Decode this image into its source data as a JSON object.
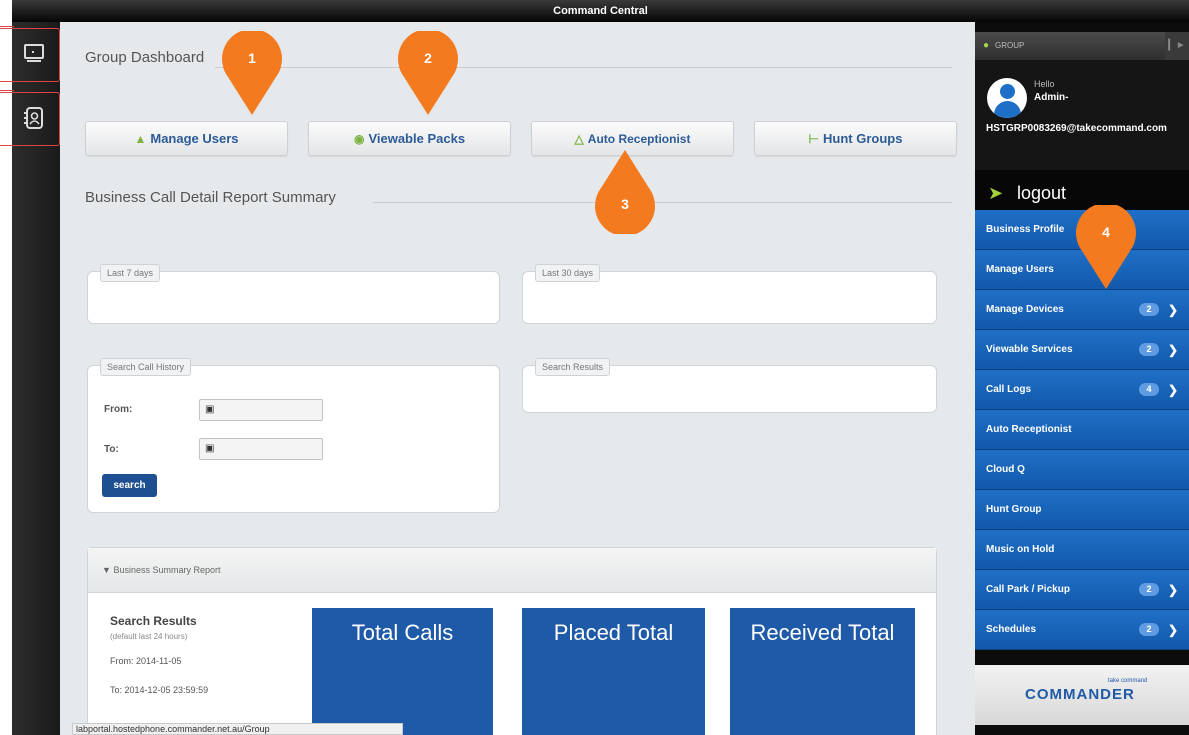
{
  "window": {
    "title": "Command Central"
  },
  "rail": {
    "items": [
      {
        "name": "desktop",
        "icon": "monitor-icon"
      },
      {
        "name": "contacts",
        "icon": "address-book-icon"
      }
    ]
  },
  "main": {
    "dashboard_title": "Group Dashboard",
    "nav_buttons": [
      {
        "label": "Manage Users",
        "icon": "user-icon",
        "icon_color": "#7cb342"
      },
      {
        "label": "Viewable Packs",
        "icon": "eye-icon",
        "icon_color": "#7cb342"
      },
      {
        "label": "Auto Receptionist",
        "icon": "org-chart-icon",
        "icon_color": "#7cb342"
      },
      {
        "label": "Hunt Groups",
        "icon": "hierarchy-icon",
        "icon_color": "#7cb342"
      }
    ],
    "report_title": "Business Call Detail Report Summary",
    "panels": {
      "last7": "Last 7 days",
      "last30": "Last 30 days",
      "search_history": "Search Call History",
      "search_results": "Search Results"
    },
    "form": {
      "from_label": "From:",
      "to_label": "To:",
      "from_value": "",
      "to_value": "",
      "search_label": "search"
    },
    "summary": {
      "header": "Business Summary Report",
      "results_title": "Search Results",
      "results_sub": "(default last 24 hours)",
      "from_line": "From: 2014-11-05",
      "to_line": "To: 2014-12-05 23:59:59",
      "tiles": [
        "Total Calls",
        "Placed Total",
        "Received Total"
      ]
    },
    "status_url": "labportal.hostedphone.commander.net.au/Group"
  },
  "sidebar": {
    "group_label": "GROUP",
    "hello": "Hello",
    "user": "Admin-",
    "email": "HSTGRP0083269@takecommand.com",
    "logout": "logout",
    "menu": [
      {
        "label": "Business Profile",
        "badge": ""
      },
      {
        "label": "Manage Users",
        "badge": ""
      },
      {
        "label": "Manage Devices",
        "badge": "2"
      },
      {
        "label": "Viewable Services",
        "badge": "2"
      },
      {
        "label": "Call Logs",
        "badge": "4"
      },
      {
        "label": "Auto Receptionist",
        "badge": ""
      },
      {
        "label": "Cloud Q",
        "badge": ""
      },
      {
        "label": "Hunt Group",
        "badge": ""
      },
      {
        "label": "Music on Hold",
        "badge": ""
      },
      {
        "label": "Call Park / Pickup",
        "badge": "2"
      },
      {
        "label": "Schedules",
        "badge": "2"
      }
    ],
    "brand_small": "take command",
    "brand_name": "COMMANDER"
  },
  "markers": [
    "1",
    "2",
    "3",
    "4"
  ],
  "colors": {
    "accent_blue": "#1e5aa7",
    "menu_blue": "#1f6fc6",
    "marker_orange": "#f47a20",
    "highlight_red": "#d44444"
  }
}
